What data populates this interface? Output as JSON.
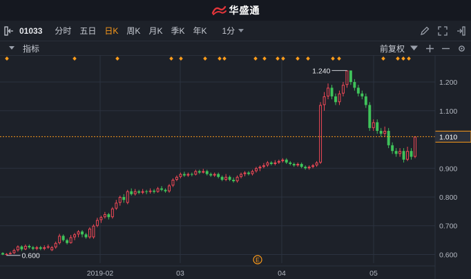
{
  "app": {
    "logo_text": "华盛通"
  },
  "toolbar": {
    "code": "01033",
    "tabs": [
      {
        "label": "分时",
        "active": false
      },
      {
        "label": "五日",
        "active": false
      },
      {
        "label": "日K",
        "active": true
      },
      {
        "label": "周K",
        "active": false
      },
      {
        "label": "月K",
        "active": false
      },
      {
        "label": "季K",
        "active": false
      },
      {
        "label": "年K",
        "active": false
      }
    ],
    "interval": "1分"
  },
  "indicator_bar": {
    "label": "指标",
    "adjust": "前复权"
  },
  "colors": {
    "up": "#f24957",
    "down": "#3fc25a",
    "accent": "#ff9c1a",
    "background": "#1d2129",
    "grid": "#2c3240"
  },
  "chart_data": {
    "type": "candlestick",
    "x_tick_labels": [
      "2019-02",
      "03",
      "04",
      "05"
    ],
    "y_tick_labels": [
      "1.200",
      "1.100",
      "1.010",
      "0.900",
      "0.800",
      "0.700",
      "0.600"
    ],
    "ylim": [
      0.57,
      1.26
    ],
    "current_price": "1.010",
    "high_marker": "1.240",
    "low_marker": "0.600",
    "event_marker": "E",
    "candles": [
      [
        0.605,
        0.6,
        0.608,
        0.598
      ],
      [
        0.6,
        0.602,
        0.605,
        0.597
      ],
      [
        0.602,
        0.605,
        0.61,
        0.6
      ],
      [
        0.605,
        0.615,
        0.62,
        0.602
      ],
      [
        0.615,
        0.628,
        0.632,
        0.61
      ],
      [
        0.628,
        0.618,
        0.632,
        0.612
      ],
      [
        0.618,
        0.63,
        0.635,
        0.615
      ],
      [
        0.63,
        0.625,
        0.635,
        0.62
      ],
      [
        0.625,
        0.62,
        0.63,
        0.615
      ],
      [
        0.62,
        0.625,
        0.63,
        0.615
      ],
      [
        0.625,
        0.62,
        0.63,
        0.615
      ],
      [
        0.62,
        0.625,
        0.632,
        0.615
      ],
      [
        0.625,
        0.628,
        0.635,
        0.62
      ],
      [
        0.615,
        0.625,
        0.63,
        0.612
      ],
      [
        0.625,
        0.64,
        0.645,
        0.62
      ],
      [
        0.64,
        0.665,
        0.672,
        0.635
      ],
      [
        0.665,
        0.65,
        0.67,
        0.645
      ],
      [
        0.65,
        0.64,
        0.655,
        0.635
      ],
      [
        0.64,
        0.66,
        0.668,
        0.638
      ],
      [
        0.66,
        0.67,
        0.675,
        0.65
      ],
      [
        0.67,
        0.68,
        0.685,
        0.66
      ],
      [
        0.68,
        0.67,
        0.685,
        0.66
      ],
      [
        0.67,
        0.66,
        0.675,
        0.655
      ],
      [
        0.66,
        0.69,
        0.695,
        0.655
      ],
      [
        0.66,
        0.7,
        0.705,
        0.655
      ],
      [
        0.7,
        0.72,
        0.728,
        0.695
      ],
      [
        0.72,
        0.73,
        0.735,
        0.71
      ],
      [
        0.73,
        0.74,
        0.748,
        0.725
      ],
      [
        0.74,
        0.73,
        0.745,
        0.722
      ],
      [
        0.73,
        0.76,
        0.765,
        0.725
      ],
      [
        0.76,
        0.78,
        0.79,
        0.755
      ],
      [
        0.78,
        0.8,
        0.805,
        0.77
      ],
      [
        0.8,
        0.79,
        0.81,
        0.78
      ],
      [
        0.78,
        0.82,
        0.825,
        0.775
      ],
      [
        0.82,
        0.81,
        0.83,
        0.805
      ],
      [
        0.81,
        0.82,
        0.828,
        0.805
      ],
      [
        0.82,
        0.815,
        0.825,
        0.81
      ],
      [
        0.815,
        0.82,
        0.828,
        0.81
      ],
      [
        0.82,
        0.818,
        0.825,
        0.81
      ],
      [
        0.818,
        0.822,
        0.83,
        0.812
      ],
      [
        0.822,
        0.818,
        0.828,
        0.812
      ],
      [
        0.818,
        0.83,
        0.835,
        0.815
      ],
      [
        0.83,
        0.825,
        0.838,
        0.82
      ],
      [
        0.825,
        0.82,
        0.83,
        0.815
      ],
      [
        0.82,
        0.84,
        0.845,
        0.815
      ],
      [
        0.84,
        0.86,
        0.865,
        0.835
      ],
      [
        0.86,
        0.87,
        0.875,
        0.855
      ],
      [
        0.87,
        0.88,
        0.885,
        0.865
      ],
      [
        0.88,
        0.875,
        0.888,
        0.87
      ],
      [
        0.875,
        0.88,
        0.885,
        0.87
      ],
      [
        0.88,
        0.878,
        0.885,
        0.872
      ],
      [
        0.878,
        0.89,
        0.895,
        0.875
      ],
      [
        0.89,
        0.885,
        0.895,
        0.88
      ],
      [
        0.885,
        0.89,
        0.898,
        0.882
      ],
      [
        0.89,
        0.88,
        0.895,
        0.875
      ],
      [
        0.88,
        0.875,
        0.885,
        0.87
      ],
      [
        0.875,
        0.88,
        0.885,
        0.87
      ],
      [
        0.88,
        0.87,
        0.885,
        0.865
      ],
      [
        0.87,
        0.86,
        0.875,
        0.855
      ],
      [
        0.86,
        0.87,
        0.88,
        0.855
      ],
      [
        0.87,
        0.86,
        0.875,
        0.855
      ],
      [
        0.86,
        0.855,
        0.868,
        0.85
      ],
      [
        0.855,
        0.87,
        0.875,
        0.85
      ],
      [
        0.87,
        0.88,
        0.885,
        0.865
      ],
      [
        0.88,
        0.885,
        0.89,
        0.872
      ],
      [
        0.885,
        0.88,
        0.89,
        0.875
      ],
      [
        0.88,
        0.89,
        0.895,
        0.875
      ],
      [
        0.89,
        0.9,
        0.905,
        0.885
      ],
      [
        0.9,
        0.905,
        0.91,
        0.89
      ],
      [
        0.905,
        0.91,
        0.918,
        0.9
      ],
      [
        0.91,
        0.92,
        0.925,
        0.905
      ],
      [
        0.92,
        0.915,
        0.925,
        0.91
      ],
      [
        0.915,
        0.92,
        0.928,
        0.91
      ],
      [
        0.92,
        0.925,
        0.93,
        0.915
      ],
      [
        0.925,
        0.93,
        0.935,
        0.92
      ],
      [
        0.93,
        0.92,
        0.935,
        0.915
      ],
      [
        0.92,
        0.915,
        0.925,
        0.91
      ],
      [
        0.915,
        0.91,
        0.92,
        0.905
      ],
      [
        0.91,
        0.915,
        0.92,
        0.905
      ],
      [
        0.915,
        0.905,
        0.92,
        0.9
      ],
      [
        0.905,
        0.9,
        0.91,
        0.895
      ],
      [
        0.9,
        0.905,
        0.91,
        0.895
      ],
      [
        0.905,
        0.91,
        0.915,
        0.9
      ],
      [
        0.91,
        0.92,
        0.925,
        0.905
      ],
      [
        0.92,
        1.12,
        1.13,
        0.915
      ],
      [
        1.12,
        1.15,
        1.165,
        1.1
      ],
      [
        1.15,
        1.18,
        1.195,
        1.14
      ],
      [
        1.18,
        1.15,
        1.19,
        1.14
      ],
      [
        1.15,
        1.13,
        1.16,
        1.12
      ],
      [
        1.13,
        1.16,
        1.17,
        1.12
      ],
      [
        1.16,
        1.19,
        1.2,
        1.15
      ],
      [
        1.19,
        1.24,
        1.24,
        1.18
      ],
      [
        1.24,
        1.2,
        1.24,
        1.19
      ],
      [
        1.2,
        1.18,
        1.21,
        1.17
      ],
      [
        1.18,
        1.16,
        1.19,
        1.15
      ],
      [
        1.16,
        1.15,
        1.17,
        1.14
      ],
      [
        1.15,
        1.12,
        1.16,
        1.11
      ],
      [
        1.12,
        1.04,
        1.13,
        1.03
      ],
      [
        1.04,
        1.06,
        1.07,
        1.03
      ],
      [
        1.06,
        1.03,
        1.07,
        1.02
      ],
      [
        1.03,
        1.02,
        1.04,
        1.01
      ],
      [
        1.02,
        1.03,
        1.045,
        1.01
      ],
      [
        1.03,
        0.98,
        1.04,
        0.97
      ],
      [
        0.98,
        0.96,
        0.99,
        0.95
      ],
      [
        0.96,
        0.95,
        0.97,
        0.94
      ],
      [
        0.95,
        0.96,
        0.97,
        0.94
      ],
      [
        0.96,
        0.93,
        0.97,
        0.92
      ],
      [
        0.93,
        0.96,
        0.975,
        0.925
      ],
      [
        0.96,
        0.94,
        0.97,
        0.93
      ],
      [
        0.94,
        1.01,
        1.01,
        0.935
      ]
    ]
  }
}
